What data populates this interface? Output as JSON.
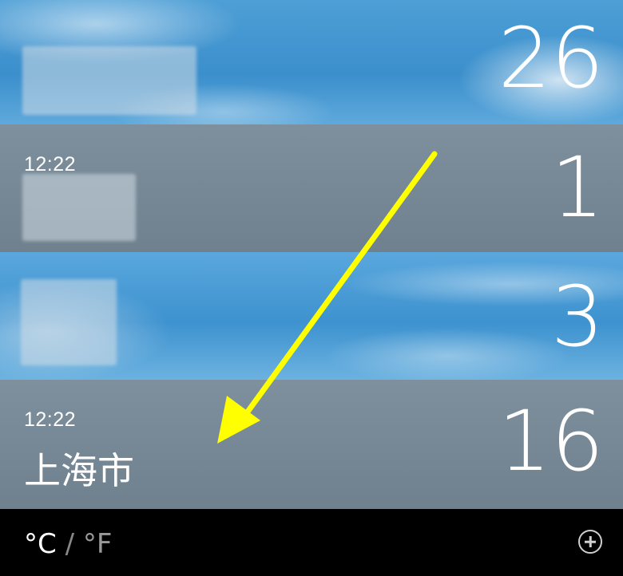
{
  "cities": [
    {
      "time": "",
      "name": "",
      "temp": "26"
    },
    {
      "time": "12:22",
      "name": "",
      "temp": "1"
    },
    {
      "time": "",
      "name": "",
      "temp": "3"
    },
    {
      "time": "12:22",
      "name": "上海市",
      "temp": "16"
    }
  ],
  "toolbar": {
    "celsius": "°C",
    "separator": "/",
    "fahrenheit": "°F",
    "add_icon": "plus-circle-icon"
  },
  "colors": {
    "annotation_arrow": "#ffff00",
    "grey_row": "#76889a"
  }
}
